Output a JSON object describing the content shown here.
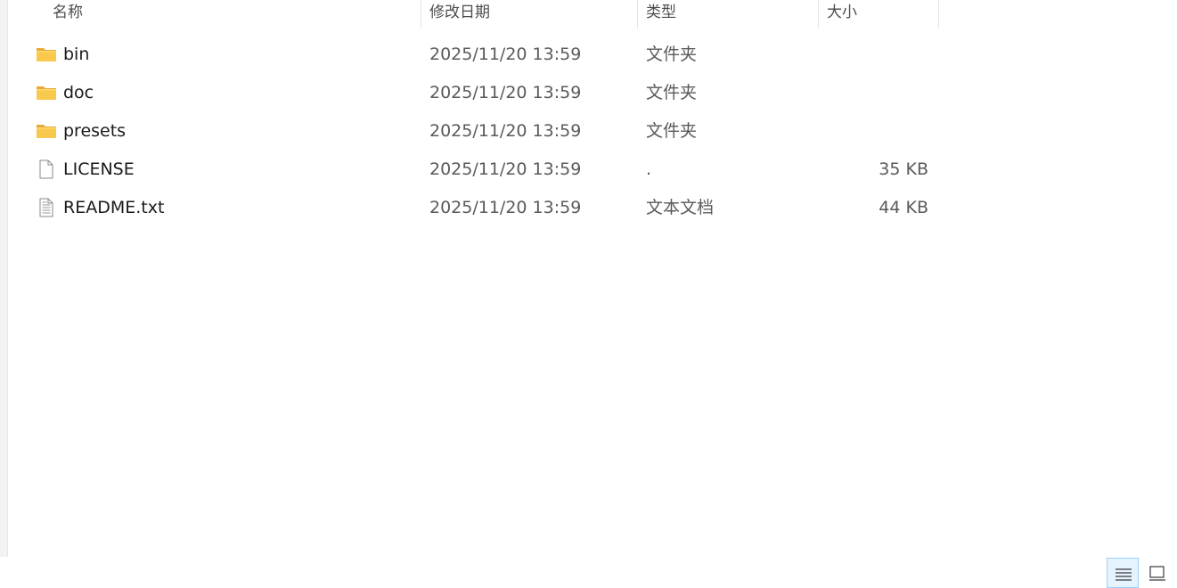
{
  "columns": {
    "name": "名称",
    "date": "修改日期",
    "type": "类型",
    "size": "大小"
  },
  "files": [
    {
      "icon": "folder-icon",
      "name": "bin",
      "date": "2025/11/20 13:59",
      "type": "文件夹",
      "size": ""
    },
    {
      "icon": "folder-icon",
      "name": "doc",
      "date": "2025/11/20 13:59",
      "type": "文件夹",
      "size": ""
    },
    {
      "icon": "folder-icon",
      "name": "presets",
      "date": "2025/11/20 13:59",
      "type": "文件夹",
      "size": ""
    },
    {
      "icon": "blank-file-icon",
      "name": "LICENSE",
      "date": "2025/11/20 13:59",
      "type": ".",
      "size": "35 KB"
    },
    {
      "icon": "text-file-icon",
      "name": "README.txt",
      "date": "2025/11/20 13:59",
      "type": "文本文档",
      "size": "44 KB"
    }
  ],
  "view_buttons": {
    "details": "details-view-icon",
    "tiles": "large-icons-view-icon"
  },
  "colors": {
    "folder": "#f8c94d",
    "selection": "#e5f3ff",
    "selection_border": "#99d1ff"
  }
}
